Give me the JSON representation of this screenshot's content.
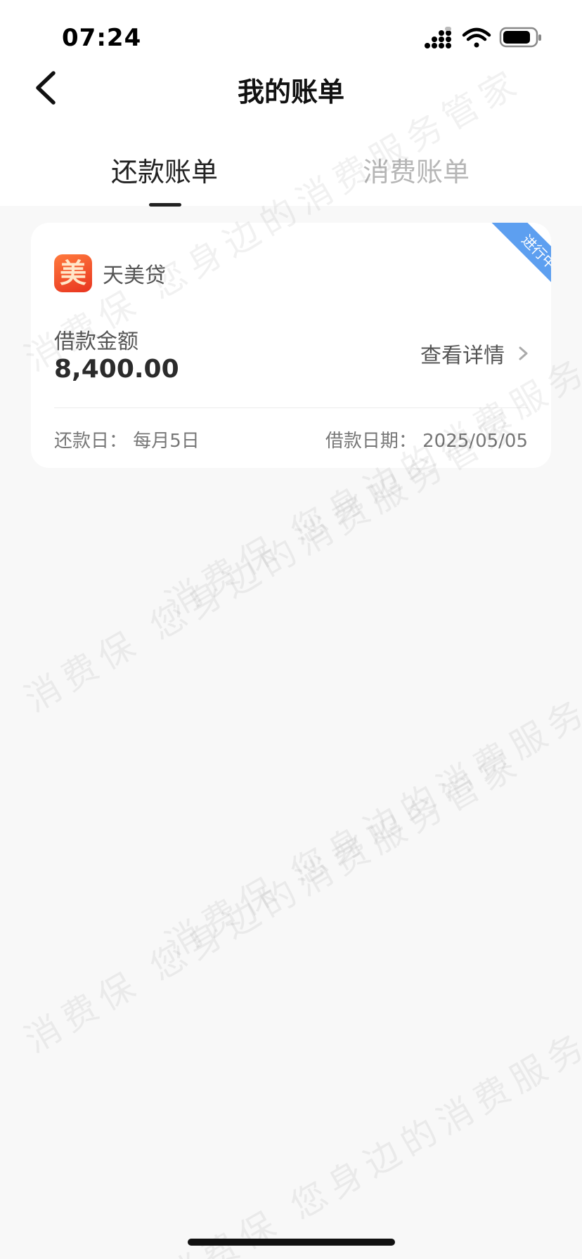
{
  "status_bar": {
    "time": "07:24"
  },
  "nav": {
    "title": "我的账单"
  },
  "tabs": [
    {
      "label": "还款账单",
      "active": true
    },
    {
      "label": "消费账单",
      "active": false
    }
  ],
  "loan_card": {
    "status_ribbon": "进行中",
    "brand_logo_char": "美",
    "brand_name": "天美贷",
    "amount_label": "借款金额",
    "amount_value": "8,400.00",
    "detail_link": "查看详情",
    "repay_day": "还款日：  每月5日",
    "loan_date": "借款日期：  2025/05/05"
  },
  "watermark": {
    "line_a": "消费保  您身边的消费服务管家",
    "line_b": "消费保  您身边的消费服务管家"
  },
  "colors": {
    "accent_blue": "#5d9ff0",
    "logo_orange": "#e8341f",
    "background": "#f8f8f8"
  }
}
